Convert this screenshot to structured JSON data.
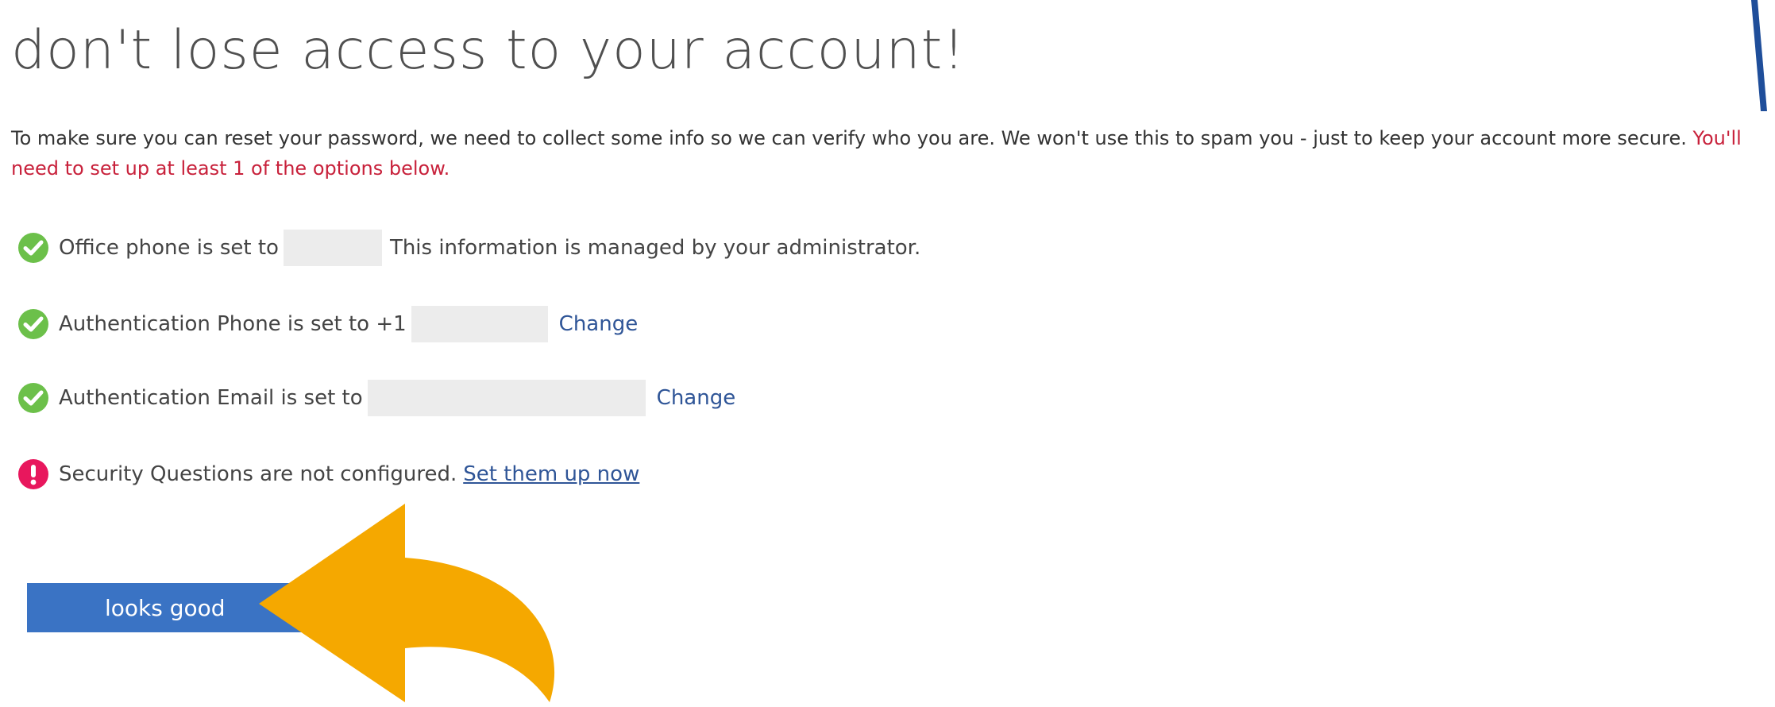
{
  "page": {
    "title": "don't lose access to your account!",
    "intro_text": "To make sure you can reset your password, we need to collect some info so we can verify who you are. We won't use this to spam you - just to keep your account more secure.",
    "intro_warning": "You'll need to set up at least 1 of the options below."
  },
  "options": {
    "office_phone": {
      "icon": "check-circle-icon",
      "label": "Office phone is set to",
      "note": "This information is managed by your administrator."
    },
    "auth_phone": {
      "icon": "check-circle-icon",
      "label": "Authentication Phone is set to +1",
      "change_label": "Change"
    },
    "auth_email": {
      "icon": "check-circle-icon",
      "label": "Authentication Email is set to",
      "change_label": "Change"
    },
    "security_questions": {
      "icon": "alert-circle-icon",
      "label": "Security Questions are not configured.",
      "setup_label": "Set them up now"
    }
  },
  "actions": {
    "confirm_label": "looks good"
  },
  "colors": {
    "success": "#6cc04a",
    "error": "#e8175d",
    "warning_text": "#c8213b",
    "link": "#2f5597",
    "button": "#3a73c4",
    "arrow": "#f5a800"
  }
}
